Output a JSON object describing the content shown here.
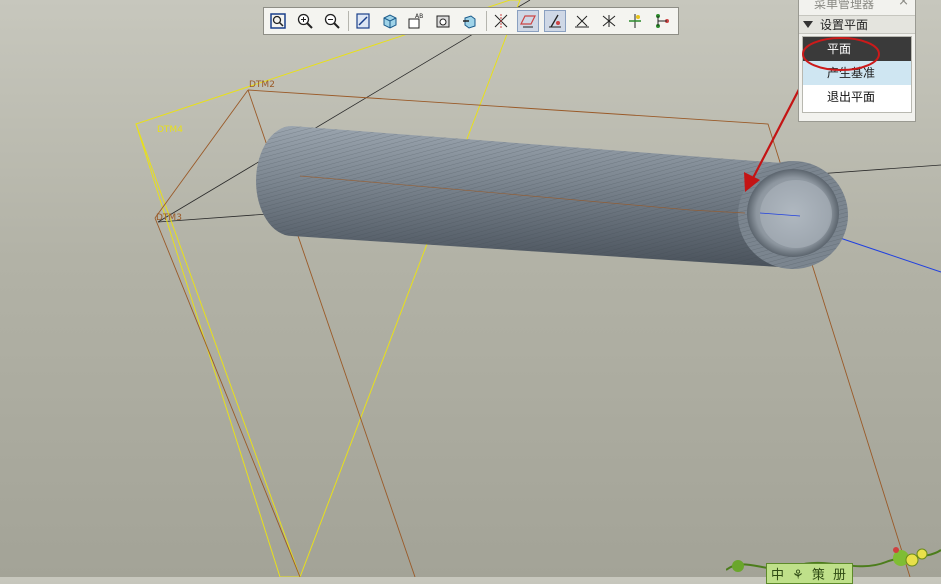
{
  "viewport": {
    "datum_labels": [
      "DTM2",
      "DTM4",
      "DTM3"
    ],
    "model": "pipe"
  },
  "toolbar": {
    "buttons": [
      {
        "name": "refit-icon",
        "active": false
      },
      {
        "name": "zoom-in-icon",
        "active": false
      },
      {
        "name": "zoom-out-icon",
        "active": false
      },
      {
        "name": "repaint-icon",
        "active": false
      },
      {
        "name": "orient-icon",
        "active": false
      },
      {
        "name": "saved-views-icon",
        "active": false
      },
      {
        "name": "layers-icon",
        "active": false
      },
      {
        "name": "model-setup-icon",
        "active": false
      },
      {
        "name": "datum-axes-icon",
        "active": false
      },
      {
        "name": "datum-planes-icon",
        "active": true
      },
      {
        "name": "datum-display-icon",
        "active": true
      },
      {
        "name": "datum-points-icon",
        "active": false
      },
      {
        "name": "coordinate-systems-icon",
        "active": false
      },
      {
        "name": "spin-center-icon",
        "active": false
      },
      {
        "name": "annotations-icon",
        "active": false
      }
    ]
  },
  "menu_manager": {
    "title": "菜单管理器",
    "close": "×",
    "section": "设置平面",
    "items": [
      "平面",
      "产生基准",
      "退出平面"
    ],
    "selected_index": 0
  },
  "decoration": {
    "text": "中 ⚘ 策 册"
  },
  "colors": {
    "highlight_circle": "#cc1a1a",
    "arrow": "#c41414",
    "datum_yellow": "#e8e01a",
    "datum_brown": "#9a5a28"
  }
}
